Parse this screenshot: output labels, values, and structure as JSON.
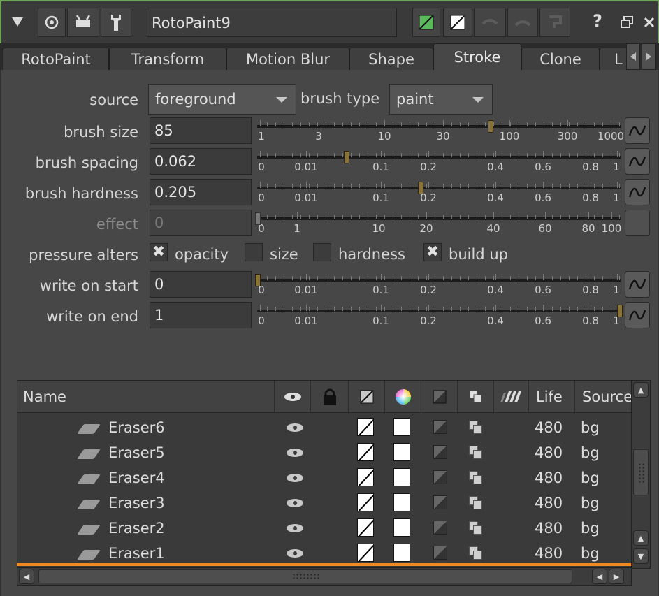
{
  "header": {
    "node_name": "RotoPaint9",
    "help_label": "?",
    "toggle_icon": "triangle-down-icon"
  },
  "tabs": [
    {
      "label": "RotoPaint"
    },
    {
      "label": "Transform"
    },
    {
      "label": "Motion Blur"
    },
    {
      "label": "Shape"
    },
    {
      "label": "Stroke",
      "active": true
    },
    {
      "label": "Clone"
    },
    {
      "label": "L"
    }
  ],
  "knobs": {
    "source": {
      "label": "source",
      "value": "foreground"
    },
    "brush_type": {
      "label": "brush type",
      "value": "paint"
    },
    "brush_size": {
      "label": "brush size",
      "value": "85",
      "ticks": [
        "1",
        "3",
        "10",
        "30",
        "100",
        "300",
        "1000"
      ]
    },
    "brush_spacing": {
      "label": "brush spacing",
      "value": "0.062",
      "ticks": [
        "0",
        "0.01",
        "0.1",
        "0.2",
        "0.4",
        "0.6",
        "0.8",
        "1"
      ]
    },
    "brush_hardness": {
      "label": "brush hardness",
      "value": "0.205",
      "ticks": [
        "0",
        "0.01",
        "0.1",
        "0.2",
        "0.4",
        "0.6",
        "0.8",
        "1"
      ]
    },
    "effect": {
      "label": "effect",
      "value": "0",
      "ticks": [
        "0",
        "1",
        "10",
        "20",
        "40",
        "60",
        "80",
        "100"
      ]
    },
    "pressure_alters": {
      "label": "pressure alters",
      "options": [
        {
          "label": "opacity",
          "checked": true
        },
        {
          "label": "size",
          "checked": false
        },
        {
          "label": "hardness",
          "checked": false
        },
        {
          "label": "build up",
          "checked": true
        }
      ]
    },
    "write_on_start": {
      "label": "write on start",
      "value": "0",
      "ticks": [
        "0",
        "0.01",
        "0.1",
        "0.2",
        "0.4",
        "0.6",
        "0.8",
        "1"
      ]
    },
    "write_on_end": {
      "label": "write on end",
      "value": "1",
      "ticks": [
        "0",
        "0.01",
        "0.1",
        "0.2",
        "0.4",
        "0.6",
        "0.8",
        "1"
      ]
    }
  },
  "list": {
    "columns": {
      "name": "Name",
      "life": "Life",
      "source": "Source"
    },
    "rows": [
      {
        "name": "Eraser6",
        "life": "480",
        "source": "bg"
      },
      {
        "name": "Eraser5",
        "life": "480",
        "source": "bg"
      },
      {
        "name": "Eraser4",
        "life": "480",
        "source": "bg"
      },
      {
        "name": "Eraser3",
        "life": "480",
        "source": "bg"
      },
      {
        "name": "Eraser2",
        "life": "480",
        "source": "bg"
      },
      {
        "name": "Eraser1",
        "life": "480",
        "source": "bg"
      }
    ]
  },
  "colors": {
    "accent_orange": "#f0891e",
    "handle": "#8a7338",
    "node_border": "#6fa35c"
  }
}
